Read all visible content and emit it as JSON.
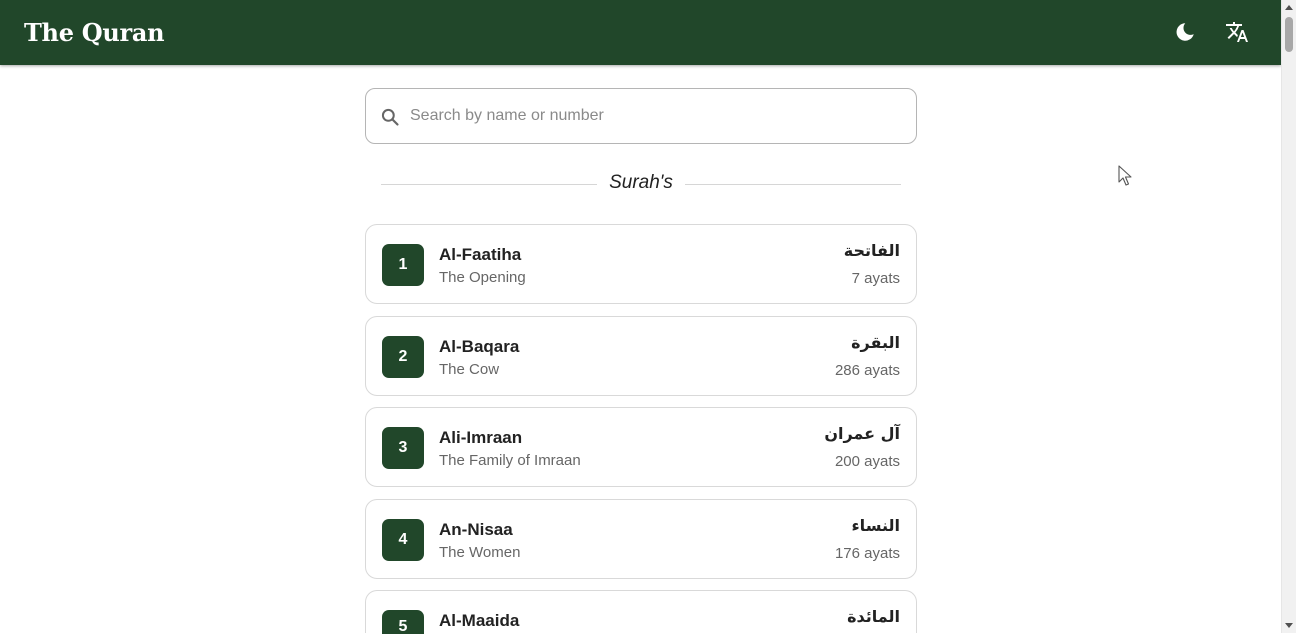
{
  "header": {
    "title": "The Quran",
    "icons": [
      "moon-icon",
      "translate-icon"
    ]
  },
  "search": {
    "placeholder": "Search by name or number",
    "value": ""
  },
  "section": {
    "title": "Surah's"
  },
  "surahs": [
    {
      "number": "1",
      "name": "Al-Faatiha",
      "meaning": "The Opening",
      "arabic": "الفاتحة",
      "ayats": "7 ayats"
    },
    {
      "number": "2",
      "name": "Al-Baqara",
      "meaning": "The Cow",
      "arabic": "البقرة",
      "ayats": "286 ayats"
    },
    {
      "number": "3",
      "name": "Ali-Imraan",
      "meaning": "The Family of Imraan",
      "arabic": "آل عمران",
      "ayats": "200 ayats"
    },
    {
      "number": "4",
      "name": "An-Nisaa",
      "meaning": "The Women",
      "arabic": "النساء",
      "ayats": "176 ayats"
    },
    {
      "number": "5",
      "name": "Al-Maaida",
      "meaning": "",
      "arabic": "المائدة",
      "ayats": ""
    }
  ],
  "colors": {
    "primary": "#21472a",
    "background": "#ffffff"
  }
}
